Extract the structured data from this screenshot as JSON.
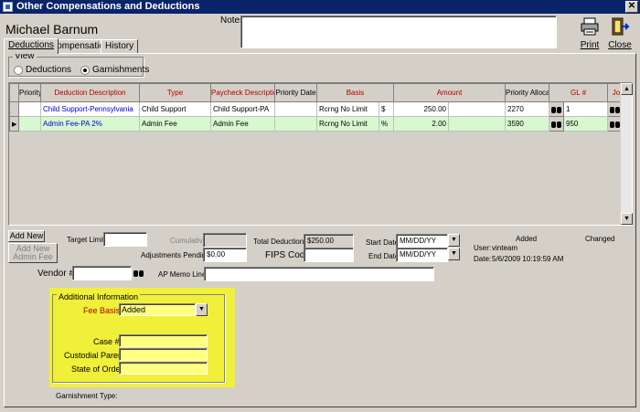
{
  "window": {
    "title": "Other Compensations and Deductions"
  },
  "employee_name": "Michael Barnum",
  "notes_label": "Notes:",
  "toolbar": {
    "print_label": "Print",
    "close_label": "Close"
  },
  "tabs": [
    {
      "label": "Deductions"
    },
    {
      "label": "Compensations"
    },
    {
      "label": "History"
    }
  ],
  "view": {
    "label": "View",
    "options": [
      {
        "label": "Deductions",
        "selected": false
      },
      {
        "label": "Garnishments",
        "selected": true
      }
    ]
  },
  "grid": {
    "columns": [
      "Priority",
      "Deduction Description",
      "Type",
      "Paycheck Description",
      "Priority Date",
      "Basis",
      "",
      "Amount",
      "Priority Allocation",
      "GL #",
      "",
      "Job #"
    ],
    "rows": [
      {
        "priority": "",
        "description": "Child Support-Pennsylvania",
        "type": "Child Support",
        "paycheck_description": "Child Support-PA",
        "priority_date": "",
        "basis": "Rcrng No Limit",
        "unit": "$",
        "amount": "250.00",
        "priority_allocation": "",
        "gl": "2270",
        "job": "1"
      },
      {
        "priority": "",
        "description": "Admin Fee-PA 2%",
        "type": "Admin Fee",
        "paycheck_description": "Admin Fee",
        "priority_date": "",
        "basis": "Rcrng No Limit",
        "unit": "%",
        "amount": "2.00",
        "priority_allocation": "",
        "gl": "3590",
        "job": "950"
      }
    ]
  },
  "buttons": {
    "add_new": "Add New",
    "add_new_admin_line1": "Add New",
    "add_new_admin_line2": "Admin Fee"
  },
  "fields": {
    "target_limit_label": "Target Limit:",
    "target_limit_value": "",
    "cumulative_label": "Cumulative:",
    "cumulative_value": "",
    "adjustments_label": "Adjustments Pending:",
    "adjustments_value": "$0.00",
    "total_deductions_label": "Total Deductions:",
    "total_deductions_value": "$250.00",
    "fips_label": "FIPS Code:",
    "fips_value": "",
    "start_date_label": "Start Date:",
    "start_date_value": "MM/DD/YY",
    "end_date_label": "End Date:",
    "end_date_value": "MM/DD/YY",
    "vendor_label": "Vendor #:",
    "vendor_value": "",
    "ap_memo_label": "AP Memo Line:",
    "ap_memo_value": ""
  },
  "audit": {
    "added_label": "Added",
    "changed_label": "Changed",
    "user_label": "User:",
    "user_value": "vinteam",
    "date_label": "Date:",
    "date_value": "5/6/2009 10:19:59 AM"
  },
  "additional_info": {
    "label": "Additional Information",
    "fee_basis_label": "Fee Basis:",
    "fee_basis_value": "Added",
    "case_label": "Case #:",
    "custodial_label": "Custodial Parent:",
    "state_label": "State of Order:"
  },
  "garnishment_type_label": "Garnishment Type:",
  "colors": {
    "highlight": "#f0f03a",
    "title_bar": "#0a246a",
    "row_green": "#d8f8d0",
    "required_label": "#b00000"
  }
}
